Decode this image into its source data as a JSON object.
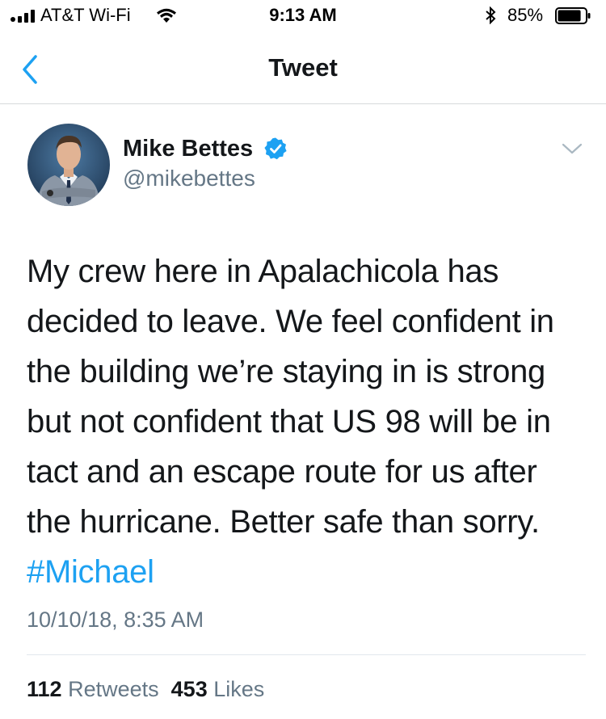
{
  "status_bar": {
    "carrier": "AT&T Wi-Fi",
    "time": "9:13 AM",
    "battery_percent": "85%",
    "battery_level": 0.85
  },
  "nav": {
    "title": "Tweet"
  },
  "tweet": {
    "author_name": "Mike Bettes",
    "author_handle": "@mikebettes",
    "text_lines": [
      "My crew here in Apalachicola has",
      "decided to leave. We feel confident in",
      "the building we’re staying in is strong",
      "but not confident that US 98 will be in",
      "tact and an escape route for us after",
      "the hurricane. Better safe than sorry."
    ],
    "hashtag": "#Michael",
    "timestamp": "10/10/18, 8:35 AM",
    "retweets_count": "112",
    "retweets_label": "Retweets",
    "likes_count": "453",
    "likes_label": "Likes"
  },
  "colors": {
    "accent": "#1da1f2",
    "muted": "#657786",
    "text": "#14171a"
  }
}
